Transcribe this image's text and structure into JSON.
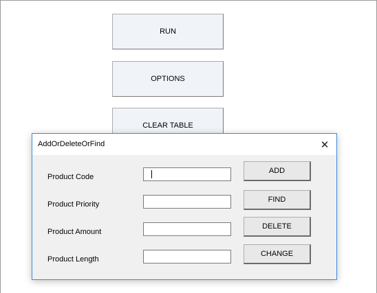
{
  "sheet": {
    "run_label": "RUN",
    "options_label": "OPTIONS",
    "clear_label": "CLEAR TABLE"
  },
  "dialog": {
    "title": "AddOrDeleteOrFind",
    "close_glyph": "✕",
    "fields": [
      {
        "label": "Product Code",
        "value": ""
      },
      {
        "label": "Product Priority",
        "value": ""
      },
      {
        "label": "Product Amount",
        "value": ""
      },
      {
        "label": "Product Length",
        "value": ""
      }
    ],
    "buttons": {
      "add": "ADD",
      "find": "FIND",
      "delete": "DELETE",
      "change": "CHANGE"
    }
  }
}
